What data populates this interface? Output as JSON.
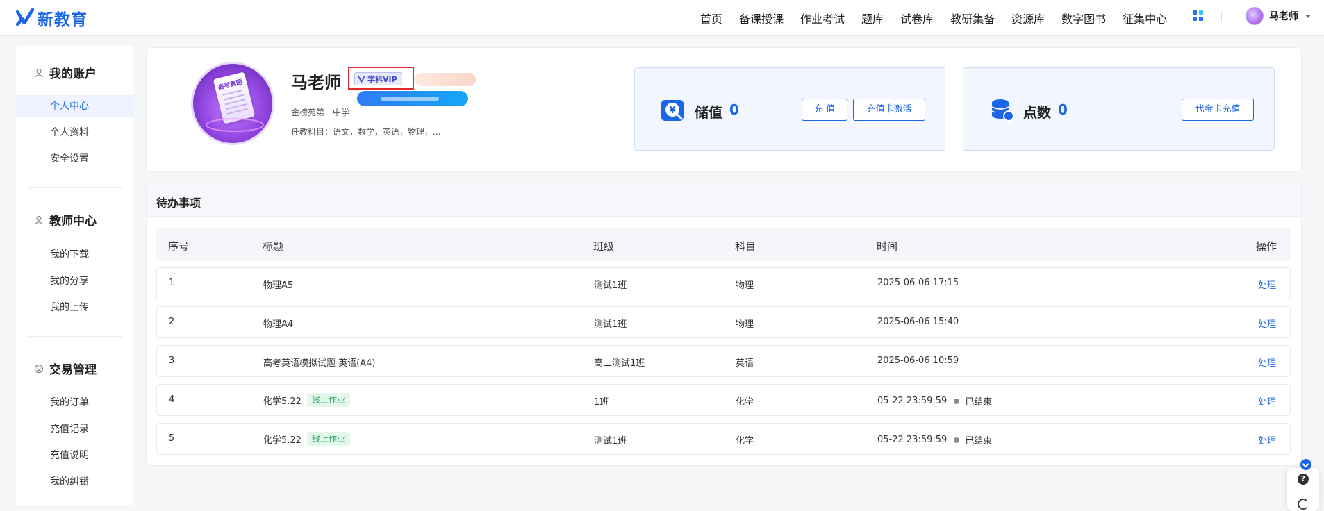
{
  "app": {
    "logo_text": "新教育"
  },
  "nav": {
    "items": [
      {
        "label": "首页"
      },
      {
        "label": "备课授课"
      },
      {
        "label": "作业考试"
      },
      {
        "label": "题库"
      },
      {
        "label": "试卷库"
      },
      {
        "label": "教研集备"
      },
      {
        "label": "资源库"
      },
      {
        "label": "数字图书"
      },
      {
        "label": "征集中心"
      }
    ],
    "apps_icon": "grid-apps-icon",
    "user_name": "马老师"
  },
  "sidebar": {
    "groups": [
      {
        "title": "我的账户",
        "icon": "user-outline-icon",
        "items": [
          {
            "label": "个人中心",
            "active": true
          },
          {
            "label": "个人资料"
          },
          {
            "label": "安全设置"
          }
        ]
      },
      {
        "title": "教师中心",
        "icon": "user-outline-icon",
        "items": [
          {
            "label": "我的下载"
          },
          {
            "label": "我的分享"
          },
          {
            "label": "我的上传"
          }
        ]
      },
      {
        "title": "交易管理",
        "icon": "user-gear-icon",
        "items": [
          {
            "label": "我的订单"
          },
          {
            "label": "充值记录"
          },
          {
            "label": "充值说明"
          },
          {
            "label": "我的纠错"
          }
        ]
      }
    ]
  },
  "profile": {
    "name": "马老师",
    "vip_label": "学科VIP",
    "avatar_text": "高考真题",
    "school": "金榜苑第一中学",
    "subjects": "任教科目：语文，数学，英语，物理，..."
  },
  "wallet": {
    "stored": {
      "label": "储值",
      "value": "0",
      "icon": "yuan-wallet-icon",
      "recharge_btn": "充 值",
      "card_btn": "充值卡激活"
    },
    "points": {
      "label": "点数",
      "value": "0",
      "icon": "coin-stack-icon",
      "voucher_btn": "代金卡充值"
    }
  },
  "todo": {
    "title": "待办事项",
    "columns": [
      "序号",
      "标题",
      "班级",
      "科目",
      "时间",
      "操作"
    ],
    "rows": [
      {
        "no": "1",
        "title": "物理A5",
        "tag": "",
        "class": "测试1班",
        "subject": "物理",
        "time": "2025-06-06 17:15",
        "status": "",
        "action": "处理"
      },
      {
        "no": "2",
        "title": "物理A4",
        "tag": "",
        "class": "测试1班",
        "subject": "物理",
        "time": "2025-06-06 15:40",
        "status": "",
        "action": "处理"
      },
      {
        "no": "3",
        "title": "高考英语模拟试题 英语(A4)",
        "tag": "",
        "class": "高二测试1班",
        "subject": "英语",
        "time": "2025-06-06 10:59",
        "status": "",
        "action": "处理"
      },
      {
        "no": "4",
        "title": "化学5.22",
        "tag": "线上作业",
        "class": "1班",
        "subject": "化学",
        "time": "05-22 23:59:59",
        "status": "已结束",
        "action": "处理"
      },
      {
        "no": "5",
        "title": "化学5.22",
        "tag": "线上作业",
        "class": "测试1班",
        "subject": "化学",
        "time": "05-22 23:59:59",
        "status": "已结束",
        "action": "处理"
      }
    ]
  },
  "help": {
    "icon": "question-icon",
    "refresh_icon": "refresh-icon",
    "badge_icon": "chevron-down-icon"
  }
}
